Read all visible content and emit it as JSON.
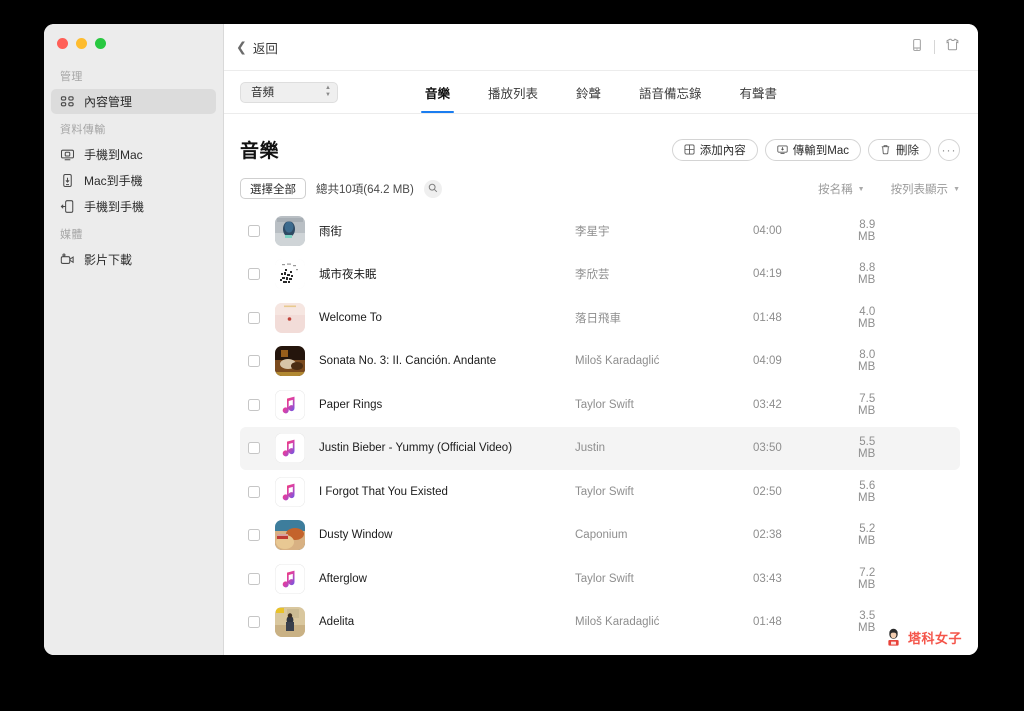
{
  "window": {
    "traffic_lights": [
      "close",
      "minimize",
      "maximize"
    ],
    "accent_blue": "#1a7df0",
    "watermark_red": "#f4554a"
  },
  "sidebar": {
    "groups": [
      {
        "label": "管理",
        "items": [
          {
            "label": "內容管理",
            "icon": "grid-icon",
            "active": true
          }
        ]
      },
      {
        "label": "資料傳輸",
        "items": [
          {
            "label": "手機到Mac",
            "icon": "phone-to-mac-icon",
            "active": false
          },
          {
            "label": "Mac到手機",
            "icon": "mac-to-phone-icon",
            "active": false
          },
          {
            "label": "手機到手機",
            "icon": "phone-to-phone-icon",
            "active": false
          }
        ]
      },
      {
        "label": "媒體",
        "items": [
          {
            "label": "影片下載",
            "icon": "video-download-icon",
            "active": false
          }
        ]
      }
    ]
  },
  "topbar": {
    "back_label": "返回",
    "right_icons": [
      "device-phone-icon",
      "toolbox-icon"
    ]
  },
  "tabbar": {
    "source_select": {
      "value": "音頻"
    },
    "tabs": [
      {
        "label": "音樂",
        "active": true
      },
      {
        "label": "播放列表",
        "active": false
      },
      {
        "label": "鈴聲",
        "active": false
      },
      {
        "label": "語音備忘錄",
        "active": false
      },
      {
        "label": "有聲書",
        "active": false
      }
    ]
  },
  "page": {
    "title": "音樂",
    "actions": [
      {
        "label": "添加內容",
        "icon": "add-content-icon"
      },
      {
        "label": "傳輸到Mac",
        "icon": "export-to-mac-icon"
      },
      {
        "label": "刪除",
        "icon": "trash-icon"
      },
      {
        "label": "···",
        "icon": "more-icon"
      }
    ],
    "select_all_label": "選擇全部",
    "count_text": "總共10項(64.2 MB)",
    "search_icon": "search-icon",
    "sort_by_label": "按名稱",
    "view_mode_label": "按列表顯示"
  },
  "tracks": [
    {
      "title": "雨街",
      "artist": "李星宇",
      "duration": "04:00",
      "size": "8.9 MB",
      "art": "photo-blue",
      "selected": false
    },
    {
      "title": "城市夜未眠",
      "artist": "李欣芸",
      "duration": "04:19",
      "size": "8.8 MB",
      "art": "photo-scribble",
      "selected": false
    },
    {
      "title": "Welcome To",
      "artist": "落日飛車",
      "duration": "01:48",
      "size": "4.0 MB",
      "art": "photo-pink",
      "selected": false
    },
    {
      "title": "Sonata No. 3: II. Canción. Andante",
      "artist": "Miloš Karadaglić",
      "duration": "04:09",
      "size": "8.0 MB",
      "art": "photo-dark",
      "selected": false
    },
    {
      "title": "Paper Rings",
      "artist": "Taylor Swift",
      "duration": "03:42",
      "size": "7.5 MB",
      "art": "music-note",
      "selected": false
    },
    {
      "title": "Justin Bieber - Yummy (Official Video)",
      "artist": "Justin",
      "duration": "03:50",
      "size": "5.5 MB",
      "art": "music-note",
      "selected": true
    },
    {
      "title": "I Forgot That You Existed",
      "artist": "Taylor Swift",
      "duration": "02:50",
      "size": "5.6 MB",
      "art": "music-note",
      "selected": false
    },
    {
      "title": "Dusty Window",
      "artist": "Caponium",
      "duration": "02:38",
      "size": "5.2 MB",
      "art": "photo-food",
      "selected": false
    },
    {
      "title": "Afterglow",
      "artist": "Taylor Swift",
      "duration": "03:43",
      "size": "7.2 MB",
      "art": "music-note",
      "selected": false
    },
    {
      "title": "Adelita",
      "artist": "Miloš Karadaglić",
      "duration": "01:48",
      "size": "3.5 MB",
      "art": "photo-beach",
      "selected": false
    }
  ],
  "watermark": {
    "text": "塔科女子"
  }
}
